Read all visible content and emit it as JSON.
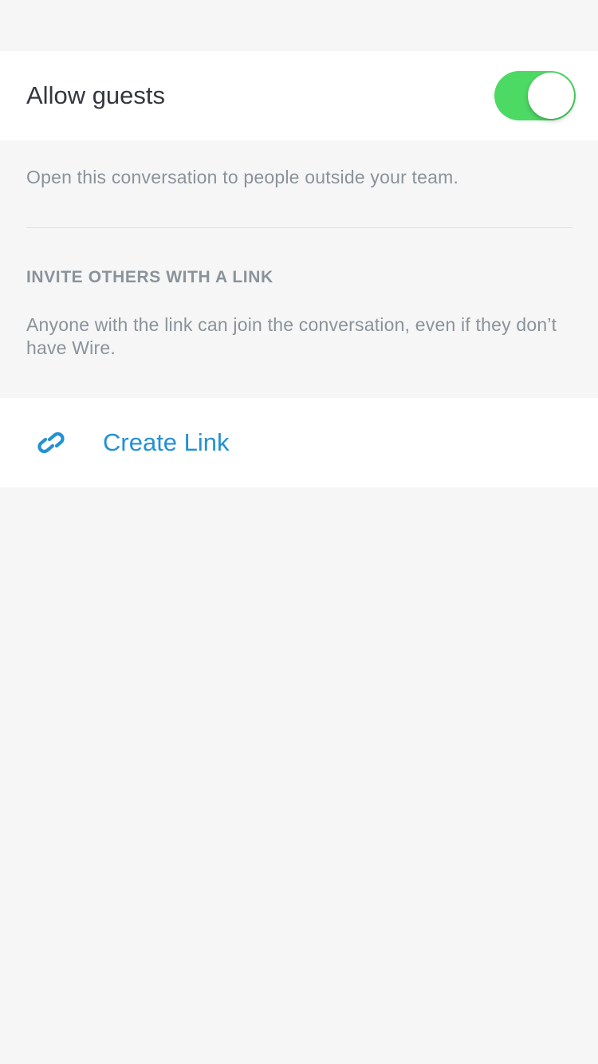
{
  "guests": {
    "label": "Allow guests",
    "toggle_on": true,
    "description": "Open this conversation to people outside your team."
  },
  "invite": {
    "header": "INVITE OTHERS WITH A LINK",
    "description": "Anyone with the link can join the conversation, even if they don’t have Wire.",
    "create_link_label": "Create Link",
    "icon": "link-icon"
  },
  "colors": {
    "background": "#f6f6f6",
    "toggle_on": "#4cd964",
    "accent": "#2391d3",
    "secondary_text": "#8b929a",
    "primary_text": "#34373d"
  }
}
